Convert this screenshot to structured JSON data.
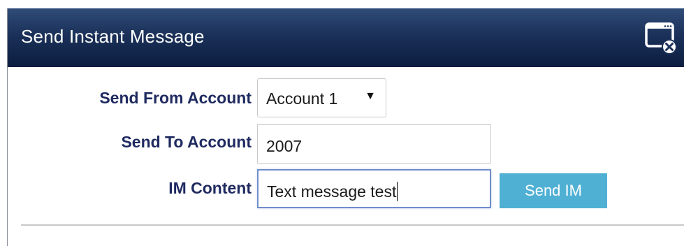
{
  "dialog": {
    "title": "Send Instant Message",
    "close_icon": "close-window-icon"
  },
  "form": {
    "send_from": {
      "label": "Send From Account",
      "selected": "Account 1",
      "arrow": "▼"
    },
    "send_to": {
      "label": "Send To Account",
      "value": "2007"
    },
    "im_content": {
      "label": "IM Content",
      "value": "Text message test"
    },
    "send_button": "Send IM"
  },
  "colors": {
    "title_bar": "#1b3159",
    "label_text": "#1f2a60",
    "send_button": "#4fb0d4"
  }
}
